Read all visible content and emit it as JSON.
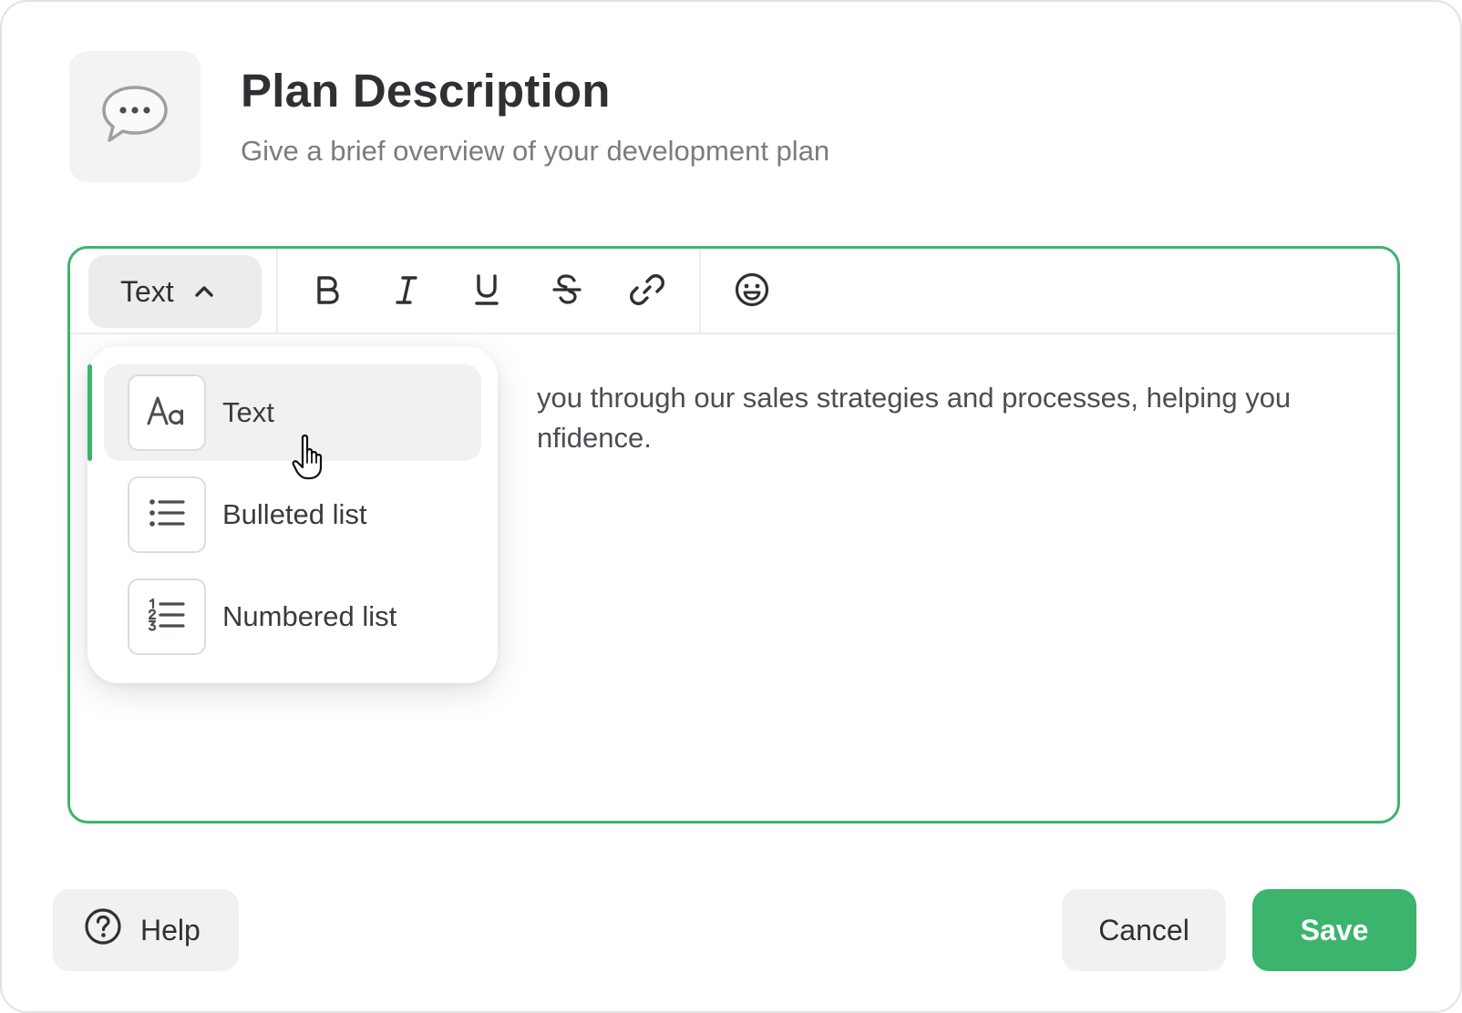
{
  "header": {
    "icon": "speech-bubble-icon",
    "title": "Plan Description",
    "subtitle": "Give a brief overview of your development plan"
  },
  "toolbar": {
    "style_select_label": "Text",
    "buttons": [
      "bold-icon",
      "italic-icon",
      "underline-icon",
      "strikethrough-icon",
      "link-icon",
      "emoji-icon"
    ]
  },
  "editor": {
    "line1": " you through our sales strategies and processes, helping you",
    "line2": "nfidence."
  },
  "dropdown": {
    "items": [
      {
        "label": "Text",
        "icon": "text-style-icon",
        "selected": true
      },
      {
        "label": "Bulleted list",
        "icon": "bulleted-list-icon",
        "selected": false
      },
      {
        "label": "Numbered list",
        "icon": "numbered-list-icon",
        "selected": false
      }
    ]
  },
  "footer": {
    "help_label": "Help",
    "cancel_label": "Cancel",
    "save_label": "Save"
  },
  "colors": {
    "accent": "#3cb46e",
    "text": "#2f3033",
    "muted": "#7a7c80",
    "surface": "#f1f1f1"
  }
}
